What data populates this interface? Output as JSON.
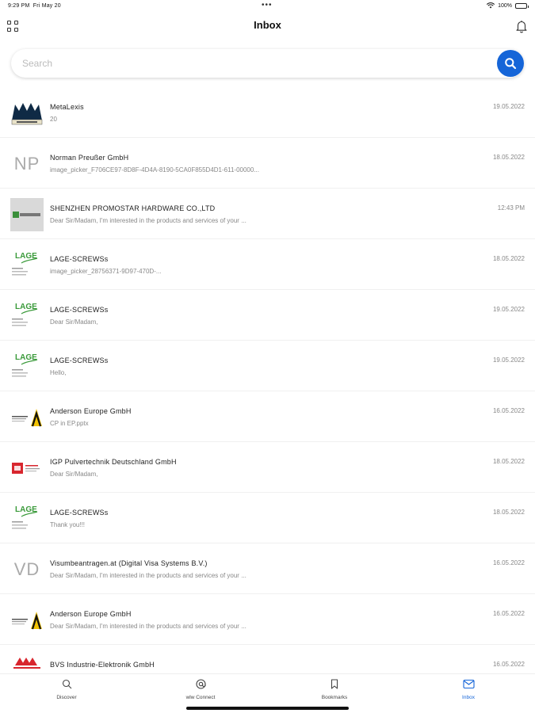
{
  "status": {
    "time": "9:29 PM",
    "date": "Fri May 20",
    "dots": "•••",
    "battery": "100%"
  },
  "header": {
    "title": "Inbox"
  },
  "search": {
    "placeholder": "Search"
  },
  "messages": [
    {
      "thumb": "metalexis-logo",
      "name": "MetaLexis",
      "preview": "20",
      "date": "19.05.2022"
    },
    {
      "thumb": "initials",
      "initials": "NP",
      "name": "Norman Preußer GmbH",
      "preview": "image_picker_F706CE97-8D8F-4D4A-8190-5CA0F855D4D1-611-00000...",
      "date": "18.05.2022"
    },
    {
      "thumb": "promostar-logo",
      "name": "SHENZHEN PROMOSTAR HARDWARE CO.,LTD",
      "preview": "Dear Sir/Madam, I'm interested in the products and services of your ...",
      "date": "12:43 PM"
    },
    {
      "thumb": "lage-logo",
      "name": "LAGE-SCREWSs",
      "preview": "image_picker_28756371-9D97-470D-...",
      "date": "18.05.2022"
    },
    {
      "thumb": "lage-logo",
      "name": "LAGE-SCREWSs",
      "preview": "Dear Sir/Madam,",
      "date": "19.05.2022"
    },
    {
      "thumb": "lage-logo",
      "name": "LAGE-SCREWSs",
      "preview": "Hello,",
      "date": "19.05.2022"
    },
    {
      "thumb": "anderson-logo",
      "name": "Anderson Europe GmbH",
      "preview": "CP in EP.pptx",
      "date": "16.05.2022"
    },
    {
      "thumb": "igp-logo",
      "name": "IGP Pulvertechnik Deutschland GmbH",
      "preview": "Dear Sir/Madam,",
      "date": "18.05.2022"
    },
    {
      "thumb": "lage-logo",
      "name": "LAGE-SCREWSs",
      "preview": "Thank you!!!",
      "date": "18.05.2022"
    },
    {
      "thumb": "initials",
      "initials": "VD",
      "name": "Visumbeantragen.at (Digital Visa Systems B.V.)",
      "preview": "Dear Sir/Madam, I'm interested in the products and services of your ...",
      "date": "16.05.2022"
    },
    {
      "thumb": "anderson-logo",
      "name": "Anderson Europe GmbH",
      "preview": "Dear Sir/Madam, I'm interested in the products and services of your ...",
      "date": "16.05.2022"
    },
    {
      "thumb": "bvs-logo",
      "name": "BVS Industrie-Elektronik GmbH",
      "preview": "",
      "date": "16.05.2022"
    }
  ],
  "tabbar": {
    "items": [
      {
        "label": "Discover",
        "icon": "search-icon"
      },
      {
        "label": "wlw Connect",
        "icon": "at-icon"
      },
      {
        "label": "Bookmarks",
        "icon": "bookmark-icon"
      },
      {
        "label": "Inbox",
        "icon": "mail-icon",
        "active": true
      }
    ]
  },
  "colors": {
    "accent": "#1565d8",
    "muted": "#888888"
  }
}
